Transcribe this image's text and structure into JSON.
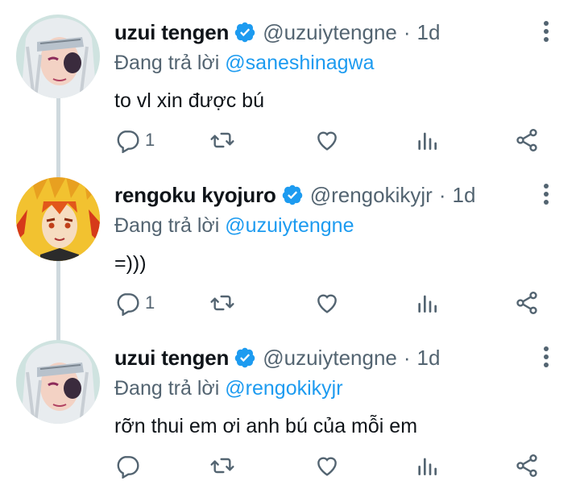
{
  "tweets": [
    {
      "name": "uzui tengen",
      "handle": "@uzuiytengne",
      "time": "1d",
      "reply_prefix": "Đang trả lời ",
      "reply_to": "@saneshinagwa",
      "text": "to vl xin được bú",
      "reply_count": "1"
    },
    {
      "name": "rengoku kyojuro",
      "handle": "@rengokikyjr",
      "time": "1d",
      "reply_prefix": "Đang trả lời ",
      "reply_to": "@uzuiytengne",
      "text": "=)))",
      "reply_count": "1"
    },
    {
      "name": "uzui tengen",
      "handle": "@uzuiytengne",
      "time": "1d",
      "reply_prefix": "Đang trả lời ",
      "reply_to": "@rengokikyjr",
      "text": "rỡn thui em ơi anh bú của mỗi em",
      "reply_count": ""
    }
  ],
  "separator": "·",
  "colors": {
    "accent": "#1d9bf0",
    "secondary": "#536471",
    "thread_line": "#cfd9de"
  },
  "icons": [
    "reply-icon",
    "retweet-icon",
    "like-icon",
    "analytics-icon",
    "share-icon",
    "more-icon",
    "verified-badge-icon"
  ]
}
